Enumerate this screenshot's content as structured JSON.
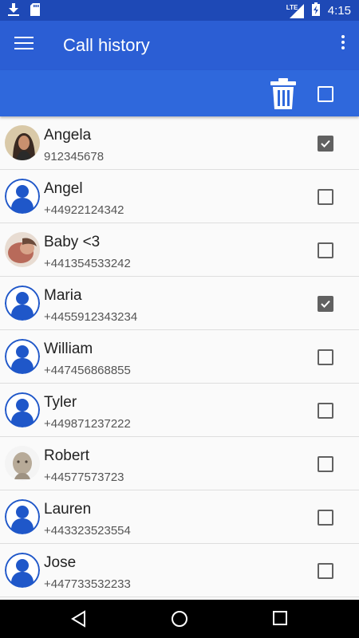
{
  "status_bar": {
    "network": "LTE",
    "time": "4:15"
  },
  "app_bar": {
    "title": "Call history"
  },
  "colors": {
    "status_bar": "#1e49b6",
    "app_bar": "#2b5ed4",
    "action_bar": "#2f68dc",
    "avatar_blue": "#1f57c9"
  },
  "select_all_checked": false,
  "contacts": [
    {
      "name": "Angela",
      "number": "912345678",
      "avatar": "photo",
      "checked": true
    },
    {
      "name": "Angel",
      "number": "+44922124342",
      "avatar": "default",
      "checked": false
    },
    {
      "name": "Baby <3",
      "number": "+441354533242",
      "avatar": "photo",
      "checked": false
    },
    {
      "name": "Maria",
      "number": "+4455912343234",
      "avatar": "default",
      "checked": true
    },
    {
      "name": "William",
      "number": "+447456868855",
      "avatar": "default",
      "checked": false
    },
    {
      "name": "Tyler",
      "number": "+449871237222",
      "avatar": "default",
      "checked": false
    },
    {
      "name": "Robert",
      "number": "+44577573723",
      "avatar": "photo",
      "checked": false
    },
    {
      "name": "Lauren",
      "number": "+443323523554",
      "avatar": "default",
      "checked": false
    },
    {
      "name": "Jose",
      "number": "+447733532233",
      "avatar": "default",
      "checked": false
    }
  ]
}
